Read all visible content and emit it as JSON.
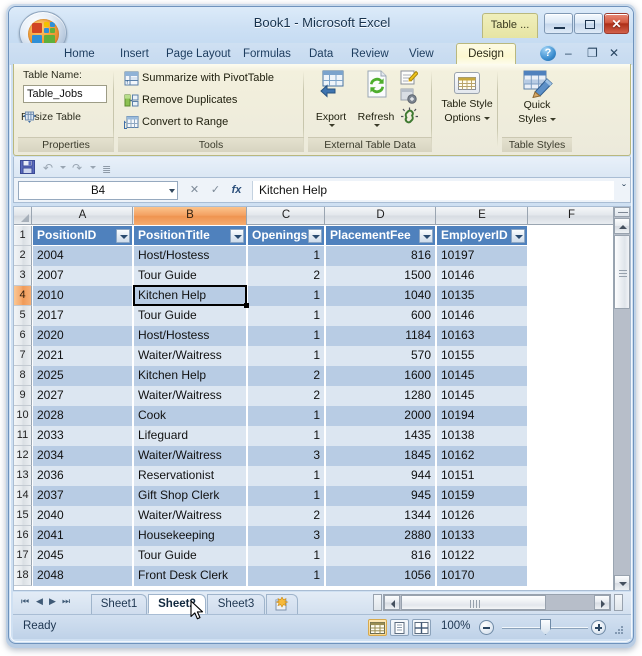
{
  "window": {
    "title": "Book1 - Microsoft Excel",
    "contextual_tab_label": "Table ...",
    "buttons": {
      "minimize": "Minimize",
      "maximize": "Maximize",
      "close": "Close"
    }
  },
  "ribbon": {
    "tabs": [
      {
        "label": "Home",
        "active": false
      },
      {
        "label": "Insert",
        "active": false
      },
      {
        "label": "Page Layout",
        "active": false
      },
      {
        "label": "Formulas",
        "active": false
      },
      {
        "label": "Data",
        "active": false
      },
      {
        "label": "Review",
        "active": false
      },
      {
        "label": "View",
        "active": false
      },
      {
        "label": "Design",
        "active": true
      }
    ],
    "help_label": "?",
    "window_controls": {
      "minimize": "–",
      "restore": "❐",
      "close": "✕"
    },
    "groups": [
      {
        "name": "Properties",
        "label": "Properties",
        "table_name_label": "Table Name:",
        "table_name_value": "Table_Jobs",
        "resize_label": "Resize Table"
      },
      {
        "name": "Tools",
        "label": "Tools",
        "items": [
          {
            "label": "Summarize with PivotTable",
            "icon": "pivottable-icon"
          },
          {
            "label": "Remove Duplicates",
            "icon": "remove-duplicates-icon"
          },
          {
            "label": "Convert to Range",
            "icon": "convert-to-range-icon"
          }
        ]
      },
      {
        "name": "External Table Data",
        "label": "External Table Data",
        "items": [
          {
            "label": "Export",
            "icon": "export-icon"
          },
          {
            "label": "Refresh",
            "icon": "refresh-icon"
          }
        ],
        "small_items": [
          {
            "label": "Properties",
            "icon": "properties-icon"
          },
          {
            "label": "Open in Browser",
            "icon": "open-in-browser-icon"
          },
          {
            "label": "Unlink",
            "icon": "unlink-icon"
          }
        ]
      },
      {
        "name": "Table Style Options",
        "label": "",
        "button_label_line1": "Table Style",
        "button_label_line2": "Options"
      },
      {
        "name": "Table Styles",
        "label": "Table Styles",
        "button_label_line1": "Quick",
        "button_label_line2": "Styles"
      }
    ]
  },
  "quick_access_toolbar": {
    "items": [
      {
        "label": "Save",
        "icon": "save-icon"
      },
      {
        "label": "Undo",
        "icon": "undo-icon"
      },
      {
        "label": "Redo",
        "icon": "redo-icon"
      },
      {
        "label": "Customize Quick Access Toolbar",
        "icon": "customize-icon"
      }
    ]
  },
  "formula_bar": {
    "name_box_value": "B4",
    "cancel_label": "✕",
    "enter_label": "✓",
    "function_label": "fx",
    "content": "Kitchen Help",
    "expand_label": "ˇ"
  },
  "grid": {
    "column_headers": [
      "A",
      "B",
      "C",
      "D",
      "E",
      "F"
    ],
    "selected_column": "B",
    "selected_row": 4,
    "selected_cell": "B4",
    "table_headers": [
      "PositionID",
      "PositionTitle",
      "Openings",
      "PlacementFee",
      "EmployerID"
    ],
    "row_numbers": [
      1,
      2,
      3,
      4,
      5,
      6,
      7,
      8,
      9,
      10,
      11,
      12,
      13,
      14,
      15,
      16,
      17,
      18
    ],
    "rows": [
      {
        "row": 2,
        "PositionID": "2004",
        "PositionTitle": "Host/Hostess",
        "Openings": "1",
        "PlacementFee": "816",
        "EmployerID": "10197"
      },
      {
        "row": 3,
        "PositionID": "2007",
        "PositionTitle": "Tour Guide",
        "Openings": "2",
        "PlacementFee": "1500",
        "EmployerID": "10146"
      },
      {
        "row": 4,
        "PositionID": "2010",
        "PositionTitle": "Kitchen Help",
        "Openings": "1",
        "PlacementFee": "1040",
        "EmployerID": "10135"
      },
      {
        "row": 5,
        "PositionID": "2017",
        "PositionTitle": "Tour Guide",
        "Openings": "1",
        "PlacementFee": "600",
        "EmployerID": "10146"
      },
      {
        "row": 6,
        "PositionID": "2020",
        "PositionTitle": "Host/Hostess",
        "Openings": "1",
        "PlacementFee": "1184",
        "EmployerID": "10163"
      },
      {
        "row": 7,
        "PositionID": "2021",
        "PositionTitle": "Waiter/Waitress",
        "Openings": "1",
        "PlacementFee": "570",
        "EmployerID": "10155"
      },
      {
        "row": 8,
        "PositionID": "2025",
        "PositionTitle": "Kitchen Help",
        "Openings": "2",
        "PlacementFee": "1600",
        "EmployerID": "10145"
      },
      {
        "row": 9,
        "PositionID": "2027",
        "PositionTitle": "Waiter/Waitress",
        "Openings": "2",
        "PlacementFee": "1280",
        "EmployerID": "10145"
      },
      {
        "row": 10,
        "PositionID": "2028",
        "PositionTitle": "Cook",
        "Openings": "1",
        "PlacementFee": "2000",
        "EmployerID": "10194"
      },
      {
        "row": 11,
        "PositionID": "2033",
        "PositionTitle": "Lifeguard",
        "Openings": "1",
        "PlacementFee": "1435",
        "EmployerID": "10138"
      },
      {
        "row": 12,
        "PositionID": "2034",
        "PositionTitle": "Waiter/Waitress",
        "Openings": "3",
        "PlacementFee": "1845",
        "EmployerID": "10162"
      },
      {
        "row": 13,
        "PositionID": "2036",
        "PositionTitle": "Reservationist",
        "Openings": "1",
        "PlacementFee": "944",
        "EmployerID": "10151"
      },
      {
        "row": 14,
        "PositionID": "2037",
        "PositionTitle": "Gift Shop Clerk",
        "Openings": "1",
        "PlacementFee": "945",
        "EmployerID": "10159"
      },
      {
        "row": 15,
        "PositionID": "2040",
        "PositionTitle": "Waiter/Waitress",
        "Openings": "2",
        "PlacementFee": "1344",
        "EmployerID": "10126"
      },
      {
        "row": 16,
        "PositionID": "2041",
        "PositionTitle": "Housekeeping",
        "Openings": "3",
        "PlacementFee": "2880",
        "EmployerID": "10133"
      },
      {
        "row": 17,
        "PositionID": "2045",
        "PositionTitle": "Tour Guide",
        "Openings": "1",
        "PlacementFee": "816",
        "EmployerID": "10122"
      },
      {
        "row": 18,
        "PositionID": "2048",
        "PositionTitle": "Front Desk Clerk",
        "Openings": "1",
        "PlacementFee": "1056",
        "EmployerID": "10170"
      }
    ]
  },
  "sheet_tabs": {
    "tabs": [
      {
        "label": "Sheet1",
        "active": false
      },
      {
        "label": "Sheet2",
        "active": true
      },
      {
        "label": "Sheet3",
        "active": false
      }
    ],
    "insert_sheet_label": "Insert Worksheet"
  },
  "status_bar": {
    "status": "Ready",
    "view_buttons": [
      {
        "label": "Normal",
        "icon": "normal-view-icon",
        "active": true
      },
      {
        "label": "Page Layout",
        "icon": "page-layout-view-icon",
        "active": false
      },
      {
        "label": "Page Break Preview",
        "icon": "page-break-view-icon",
        "active": false
      }
    ],
    "zoom_level": "100%",
    "zoom_out_label": "−",
    "zoom_in_label": "+"
  },
  "colors": {
    "table_header_blue": "#4f81bd",
    "band_dark": "#b8cce4",
    "band_light": "#dce6f1",
    "selected_header_orange": "#f4a263",
    "contextual_tab": "#e6e4a4"
  }
}
